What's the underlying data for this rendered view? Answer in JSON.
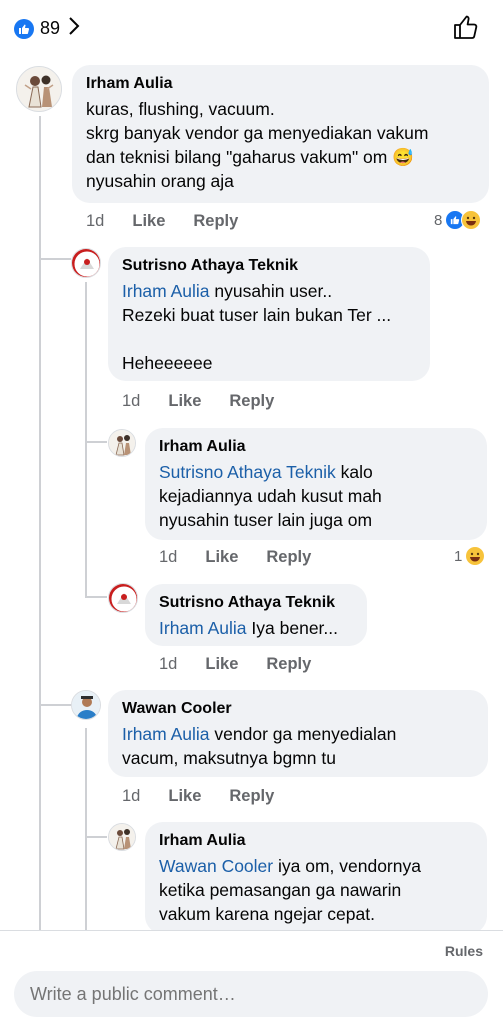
{
  "header": {
    "reaction_count": "89",
    "icons": [
      "like-icon",
      "chevron-right-icon",
      "thumbs-up-outline-icon"
    ]
  },
  "comments": [
    {
      "author": "Irham Aulia",
      "lines": [
        "kuras, flushing, vacuum.",
        "skrg banyak vendor ga menyediakan vakum",
        "dan teknisi bilang \"gaharus vakum\" om",
        "nyusahin orang aja"
      ],
      "emoji": "😅",
      "time": "1d",
      "like": "Like",
      "reply": "Reply",
      "reaction_count": "8"
    },
    {
      "author": "Sutrisno Athaya Teknik",
      "mention": "Irham Aulia",
      "line1_rest": " nyusahin user..",
      "line2": "Rezeki buat tuser lain bukan Ter ...",
      "line3": "Heheeeeee",
      "time": "1d",
      "like": "Like",
      "reply": "Reply"
    },
    {
      "author": "Irham Aulia",
      "mention": "Sutrisno Athaya Teknik",
      "line1_rest": " kalo",
      "line2": "kejadiannya udah kusut mah",
      "line3": "nyusahin tuser lain juga om",
      "time": "1d",
      "like": "Like",
      "reply": "Reply",
      "reaction_count": "1"
    },
    {
      "author": "Sutrisno Athaya Teknik",
      "mention": "Irham Aulia",
      "line1_rest": " Iya bener...",
      "time": "1d",
      "like": "Like",
      "reply": "Reply"
    },
    {
      "author": "Wawan Cooler",
      "mention": "Irham Aulia",
      "line1_rest": " vendor ga menyedialan",
      "line2": "vacum, maksutnya bgmn tu",
      "time": "1d",
      "like": "Like",
      "reply": "Reply"
    },
    {
      "author": "Irham Aulia",
      "mention": "Wawan Cooler",
      "line1_rest": " iya om, vendornya",
      "line2": "ketika pemasangan ga nawarin",
      "line3": "vakum karena ngejar cepat."
    }
  ],
  "footer": {
    "rules": "Rules",
    "placeholder": "Write a public comment…"
  },
  "colors": {
    "like_blue": "#1877f2",
    "mention": "#1b5fa8",
    "bubble": "#f0f2f5",
    "meta": "#65676b"
  }
}
